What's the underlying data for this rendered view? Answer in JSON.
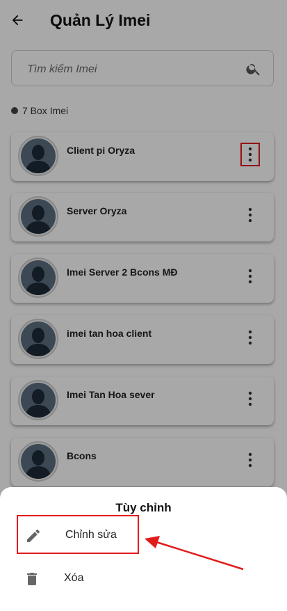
{
  "header": {
    "title": "Quản Lý Imei",
    "back_icon": "arrow-left-icon"
  },
  "search": {
    "placeholder": "Tìm kiếm Imei",
    "value": "",
    "icon": "search-icon"
  },
  "count_label": "7 Box Imei",
  "items": [
    {
      "name": "Client pi Oryza",
      "highlighted": true
    },
    {
      "name": "Server Oryza"
    },
    {
      "name": "Imei Server 2 Bcons MĐ"
    },
    {
      "name": "imei tan hoa client"
    },
    {
      "name": "Imei Tan Hoa sever"
    },
    {
      "name": "Bcons"
    }
  ],
  "sheet": {
    "title": "Tùy chỉnh",
    "actions": [
      {
        "label": "Chỉnh sửa",
        "icon": "pencil-icon"
      },
      {
        "label": "Xóa",
        "icon": "trash-icon"
      }
    ]
  },
  "colors": {
    "highlight": "#e21b1b",
    "avatar_bg": "#5c6f80",
    "overlay": "rgba(0,0,0,0.34)"
  }
}
